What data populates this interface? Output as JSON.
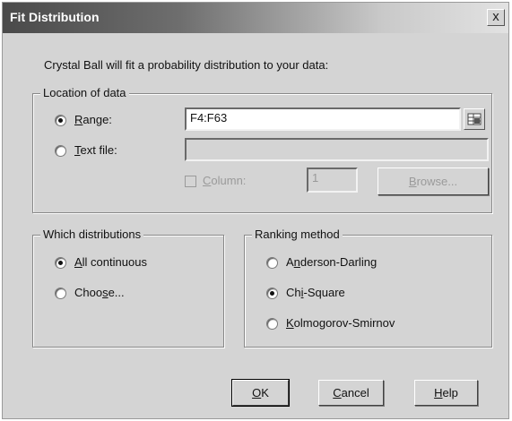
{
  "window": {
    "title": "Fit Distribution",
    "close_glyph": "x"
  },
  "intro_text": "Crystal Ball will fit a probability distribution to your data:",
  "location_group": {
    "legend": "Location of data",
    "range_label": "Range:",
    "range_value": "F4:F63",
    "textfile_label": "Text file:",
    "textfile_value": "",
    "column_label": "Column:",
    "column_value": "1",
    "browse_label": "Browse...",
    "selected": "range"
  },
  "distributions_group": {
    "legend": "Which distributions",
    "options": [
      "All continuous",
      "Choose..."
    ],
    "selected": "All continuous"
  },
  "ranking_group": {
    "legend": "Ranking method",
    "options": [
      "Anderson-Darling",
      "Chi-Square",
      "Kolmogorov-Smirnov"
    ],
    "selected": "Chi-Square"
  },
  "buttons": {
    "ok": "OK",
    "cancel": "Cancel",
    "help": "Help"
  },
  "icons": {
    "range_picker": "cell-range-picker-icon"
  }
}
